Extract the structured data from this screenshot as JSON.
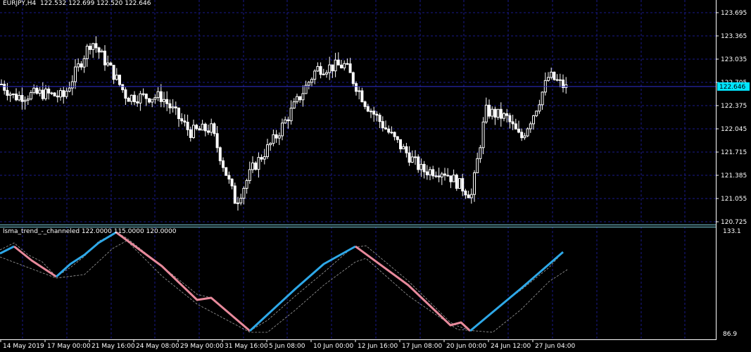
{
  "header": {
    "symbol_timeframe": "EURJPY,H4",
    "ohlc": "122.532 122.699 122.520 122.646"
  },
  "indicator": {
    "title": "lsma_trend_-_channeled 122.0000 115.0000 120.0000"
  },
  "price_axis": {
    "ticks": [
      "123.695",
      "123.365",
      "123.035",
      "122.705",
      "122.375",
      "122.045",
      "121.715",
      "121.385",
      "121.055",
      "120.725"
    ],
    "current_price": "122.646",
    "current_price_bg": "#00e5ff"
  },
  "indicator_axis": {
    "top": "133.1",
    "bottom": "86.9"
  },
  "time_axis": {
    "labels": [
      "14 May 2019",
      "17 May 00:00",
      "21 May 16:00",
      "24 May 08:00",
      "29 May 00:00",
      "31 May 16:00",
      "5 Jun 08:00",
      "10 Jun 00:00",
      "12 Jun 16:00",
      "17 Jun 08:00",
      "20 Jun 00:00",
      "24 Jun 12:00",
      "27 Jun 04:00"
    ]
  },
  "colors": {
    "background": "#000000",
    "grid": "#1a1a8c",
    "candles": "#ffffff",
    "separator": "#7fd3e0",
    "up_trend": "#2ea8e8",
    "down_trend": "#e88a9c",
    "channel": "#a0a0a0"
  },
  "chart_data": {
    "type": "line",
    "series": [
      {
        "values": [
          {
            "x": "14 May 2019",
            "y": 122.55
          },
          {
            "x": "17 May 00:00",
            "y": 122.45
          },
          {
            "x": "21 May 16:00",
            "y": 123.3
          },
          {
            "x": "24 May 08:00",
            "y": 122.5
          },
          {
            "x": "29 May 00:00",
            "y": 122.0
          },
          {
            "x": "31 May 16:00",
            "y": 121.0
          },
          {
            "x": "5 Jun 08:00",
            "y": 121.9
          },
          {
            "x": "10 Jun 00:00",
            "y": 122.9
          },
          {
            "x": "12 Jun 16:00",
            "y": 122.3
          },
          {
            "x": "17 Jun 08:00",
            "y": 121.45
          },
          {
            "x": "20 Jun 00:00",
            "y": 121.1
          },
          {
            "x": "24 Jun 12:00",
            "y": 122.3
          },
          {
            "x": "27 Jun 04:00",
            "y": 122.646
          }
        ]
      }
    ],
    "current_price": 122.646
  }
}
